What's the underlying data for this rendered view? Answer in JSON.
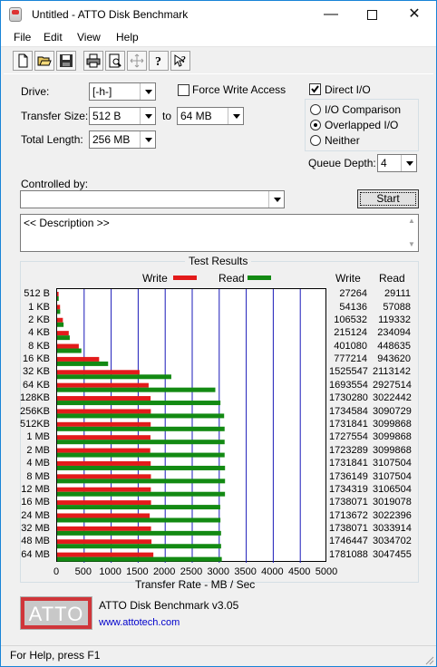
{
  "window": {
    "title": "Untitled - ATTO Disk Benchmark"
  },
  "menu": [
    "File",
    "Edit",
    "View",
    "Help"
  ],
  "toolbar": [
    "new-document-icon",
    "open-folder-icon",
    "save-icon",
    "print-icon",
    "print-preview-icon",
    "move-icon",
    "help-icon",
    "context-help-icon"
  ],
  "drive": {
    "label": "Drive:",
    "value": "[-h-]"
  },
  "force_write": {
    "label": "Force Write Access",
    "checked": false
  },
  "direct_io": {
    "label": "Direct I/O",
    "checked": true
  },
  "transfer_size": {
    "label": "Transfer Size:",
    "from": "512 B",
    "to_label": "to",
    "to": "64 MB"
  },
  "total_length": {
    "label": "Total Length:",
    "value": "256 MB"
  },
  "io_mode": {
    "options": [
      "I/O Comparison",
      "Overlapped I/O",
      "Neither"
    ],
    "selected": "Overlapped I/O"
  },
  "queue_depth": {
    "label": "Queue Depth:",
    "value": "4"
  },
  "controlled_by": {
    "label": "Controlled by:",
    "value": ""
  },
  "start_button": "Start",
  "description": "<< Description >>",
  "results": {
    "title": "Test Results",
    "write_col": "Write",
    "read_col": "Read",
    "write_legend": "Write",
    "read_legend": "Read"
  },
  "colors": {
    "write": "#e31b1b",
    "read": "#138a13",
    "grid": "#1a1ab8"
  },
  "chart_data": {
    "type": "bar",
    "orientation": "horizontal",
    "xlabel": "Transfer Rate - MB / Sec",
    "xlim": [
      0,
      5000
    ],
    "xticks": [
      0,
      500,
      1000,
      1500,
      2000,
      2500,
      3000,
      3500,
      4000,
      4500,
      5000
    ],
    "legend": "top",
    "categories": [
      "512 B",
      "1 KB",
      "2 KB",
      "4 KB",
      "8 KB",
      "16 KB",
      "32 KB",
      "64 KB",
      "128KB",
      "256KB",
      "512KB",
      "1 MB",
      "2 MB",
      "4 MB",
      "8 MB",
      "12 MB",
      "16 MB",
      "24 MB",
      "32 MB",
      "48 MB",
      "64 MB"
    ],
    "series": [
      {
        "name": "Write",
        "values": [
          27264,
          54136,
          106532,
          215124,
          401080,
          777214,
          1525547,
          1693554,
          1730280,
          1734584,
          1731841,
          1727554,
          1723289,
          1731841,
          1736149,
          1734319,
          1738071,
          1713672,
          1738071,
          1746447,
          1781088
        ]
      },
      {
        "name": "Read",
        "values": [
          29111,
          57088,
          119332,
          234094,
          448635,
          943620,
          2113142,
          2927514,
          3022442,
          3090729,
          3099868,
          3099868,
          3099868,
          3107504,
          3107504,
          3106504,
          3019078,
          3022396,
          3033914,
          3034702,
          3047455
        ]
      }
    ]
  },
  "footer": {
    "product": "ATTO Disk Benchmark v3.05",
    "url": "www.attotech.com",
    "logo": "ATTO"
  },
  "status": "For Help, press F1"
}
